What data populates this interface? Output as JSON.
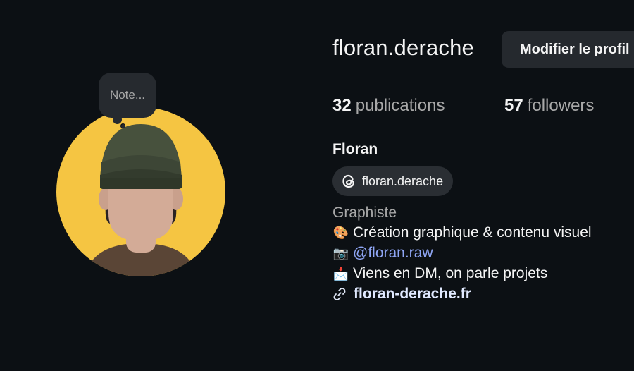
{
  "profile": {
    "username": "floran.derache",
    "edit_button_label": "Modifier le profil",
    "note_placeholder": "Note...",
    "stats": {
      "posts_count": "32",
      "posts_label": "publications",
      "followers_count": "57",
      "followers_label": "followers"
    },
    "display_name": "Floran",
    "threads_handle": "floran.derache",
    "category": "Graphiste",
    "bio": {
      "line1_icon": "palette-emoji",
      "line1_text": "Création graphique & contenu visuel",
      "line2_icon": "camera-emoji",
      "line2_text": "@floran.raw",
      "line3_icon": "inbox-tray-emoji",
      "line3_text": "Viens en DM, on parle projets"
    },
    "website": "floran-derache.fr"
  },
  "colors": {
    "background": "#0c1014",
    "avatar_bg": "#f5c542",
    "button_bg": "#25292e",
    "mention": "#8fa6f5",
    "muted_text": "#a8a8a8"
  }
}
